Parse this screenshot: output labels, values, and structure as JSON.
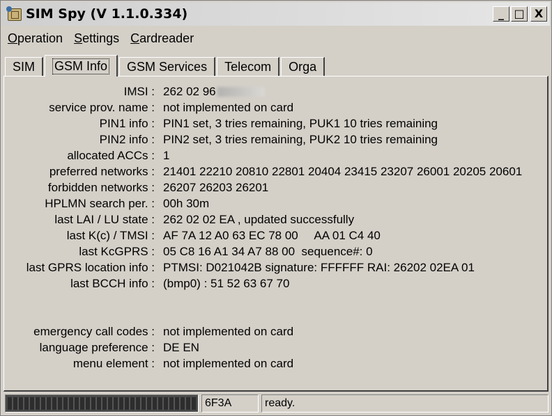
{
  "window": {
    "title": "SIM Spy  (V 1.1.0.334)"
  },
  "controls": {
    "minimize": "_",
    "maximize": "□",
    "close": "X"
  },
  "menu": {
    "items": [
      {
        "first": "O",
        "rest": "peration"
      },
      {
        "first": "S",
        "rest": "ettings"
      },
      {
        "first": "C",
        "rest": "ardreader"
      }
    ]
  },
  "tabs": [
    "SIM",
    "GSM Info",
    "GSM Services",
    "Telecom",
    "Orga"
  ],
  "active_tab": "GSM Info",
  "info": {
    "imsi": {
      "label": "IMSI :",
      "value": "262 02 96"
    },
    "spn": {
      "label": "service prov. name :",
      "value": "not implemented on card"
    },
    "pin1": {
      "label": "PIN1 info :",
      "value": "PIN1 set, 3 tries remaining, PUK1 10 tries remaining"
    },
    "pin2": {
      "label": "PIN2 info :",
      "value": "PIN2 set, 3 tries remaining, PUK2 10 tries remaining"
    },
    "acc": {
      "label": "allocated ACCs :",
      "value": "1"
    },
    "preferred": {
      "label": "preferred networks :",
      "value": "21401 22210 20810 22801 20404 23415 23207 26001 20205 20601"
    },
    "forbidden": {
      "label": "forbidden networks :",
      "value": "26207 26203 26201"
    },
    "hplmn": {
      "label": "HPLMN search per. :",
      "value": "00h 30m"
    },
    "lai": {
      "label": "last LAI / LU state :",
      "value": "262 02  02 EA , updated successfully"
    },
    "kc": {
      "label": "last K(c) / TMSI :",
      "value": "AF 7A 12 A0 63 EC 78 00     AA 01 C4 40"
    },
    "kcgprs": {
      "label": "last KcGPRS :",
      "value": "05 C8 16 A1 34 A7 88 00  sequence#: 0"
    },
    "gprs_loc": {
      "label": "last GPRS location info :",
      "value": "PTMSI: D021042B signature: FFFFFF RAI: 26202 02EA 01"
    },
    "bcch": {
      "label": "last BCCH info :",
      "value": "(bmp0) : 51 52 63 67 70"
    },
    "ecc": {
      "label": "emergency call codes :",
      "value": "not implemented on card"
    },
    "lang": {
      "label": "language preference :",
      "value": "DE EN"
    },
    "menu_el": {
      "label": "menu element :",
      "value": "not implemented on card"
    }
  },
  "status": {
    "progress": 1.0,
    "code": "6F3A",
    "text": "ready."
  }
}
